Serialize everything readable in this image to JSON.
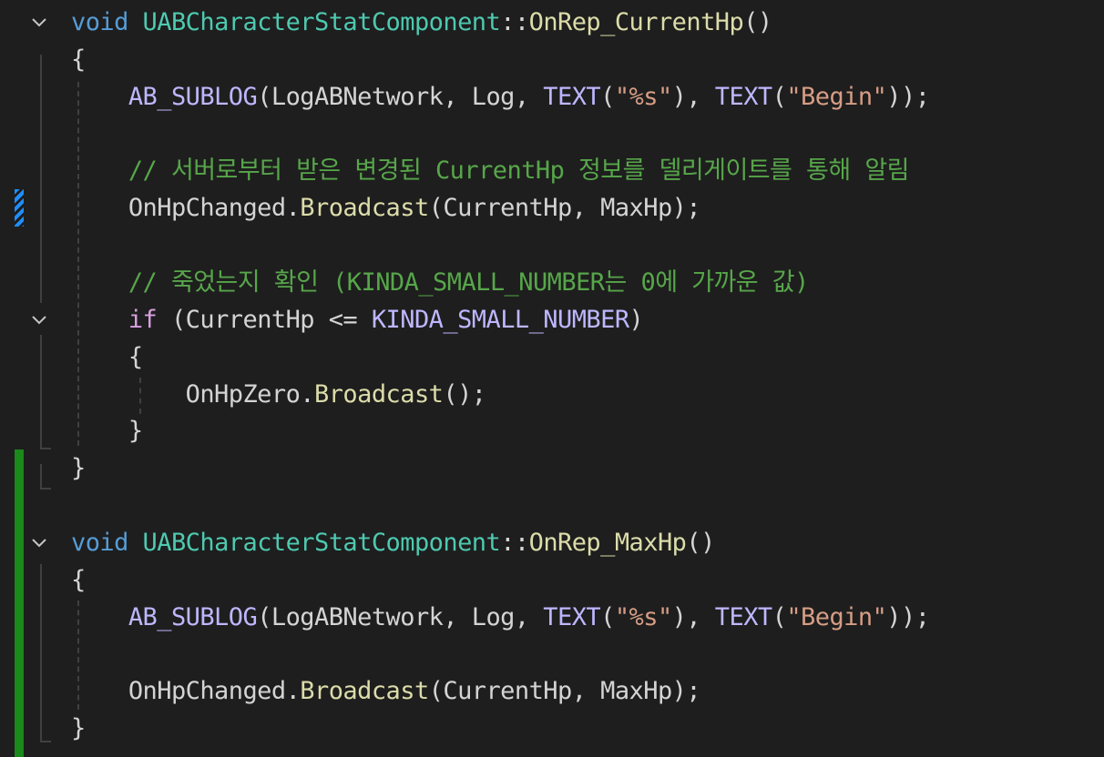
{
  "editor": {
    "lines": [
      {
        "foldable": true,
        "tokens": [
          {
            "t": "kw",
            "v": "void"
          },
          {
            "t": "p",
            "v": " "
          },
          {
            "t": "cls",
            "v": "UABCharacterStatComponent"
          },
          {
            "t": "p",
            "v": "::"
          },
          {
            "t": "fn",
            "v": "OnRep_CurrentHp"
          },
          {
            "t": "p",
            "v": "()"
          }
        ]
      },
      {
        "tokens": [
          {
            "t": "p",
            "v": "{"
          }
        ]
      },
      {
        "tokens": [
          {
            "t": "p",
            "v": "    "
          },
          {
            "t": "macro",
            "v": "AB_SUBLOG"
          },
          {
            "t": "p",
            "v": "(LogABNetwork, Log, "
          },
          {
            "t": "macro",
            "v": "TEXT"
          },
          {
            "t": "p",
            "v": "("
          },
          {
            "t": "str",
            "v": "\"%s\""
          },
          {
            "t": "p",
            "v": "), "
          },
          {
            "t": "macro",
            "v": "TEXT"
          },
          {
            "t": "p",
            "v": "("
          },
          {
            "t": "str",
            "v": "\"Begin\""
          },
          {
            "t": "p",
            "v": "));"
          }
        ]
      },
      {
        "tokens": []
      },
      {
        "tokens": [
          {
            "t": "p",
            "v": "    "
          },
          {
            "t": "cmt",
            "v": "// 서버로부터 받은 변경된 CurrentHp 정보를 델리게이트를 통해 알림"
          }
        ]
      },
      {
        "tokens": [
          {
            "t": "p",
            "v": "    OnHpChanged."
          },
          {
            "t": "fn",
            "v": "Broadcast"
          },
          {
            "t": "p",
            "v": "(CurrentHp, MaxHp);"
          }
        ]
      },
      {
        "tokens": []
      },
      {
        "tokens": [
          {
            "t": "p",
            "v": "    "
          },
          {
            "t": "cmt",
            "v": "// 죽었는지 확인 (KINDA_SMALL_NUMBER는 0에 가까운 값)"
          }
        ]
      },
      {
        "foldable": true,
        "tokens": [
          {
            "t": "p",
            "v": "    "
          },
          {
            "t": "ctl",
            "v": "if"
          },
          {
            "t": "p",
            "v": " (CurrentHp <= "
          },
          {
            "t": "macro",
            "v": "KINDA_SMALL_NUMBER"
          },
          {
            "t": "p",
            "v": ")"
          }
        ]
      },
      {
        "tokens": [
          {
            "t": "p",
            "v": "    {"
          }
        ]
      },
      {
        "tokens": [
          {
            "t": "p",
            "v": "        OnHpZero."
          },
          {
            "t": "fn",
            "v": "Broadcast"
          },
          {
            "t": "p",
            "v": "();"
          }
        ]
      },
      {
        "tokens": [
          {
            "t": "p",
            "v": "    }"
          }
        ]
      },
      {
        "tokens": [
          {
            "t": "p",
            "v": "}"
          }
        ]
      },
      {
        "tokens": []
      },
      {
        "foldable": true,
        "tokens": [
          {
            "t": "kw",
            "v": "void"
          },
          {
            "t": "p",
            "v": " "
          },
          {
            "t": "cls",
            "v": "UABCharacterStatComponent"
          },
          {
            "t": "p",
            "v": "::"
          },
          {
            "t": "fn",
            "v": "OnRep_MaxHp"
          },
          {
            "t": "p",
            "v": "()"
          }
        ]
      },
      {
        "tokens": [
          {
            "t": "p",
            "v": "{"
          }
        ]
      },
      {
        "tokens": [
          {
            "t": "p",
            "v": "    "
          },
          {
            "t": "macro",
            "v": "AB_SUBLOG"
          },
          {
            "t": "p",
            "v": "(LogABNetwork, Log, "
          },
          {
            "t": "macro",
            "v": "TEXT"
          },
          {
            "t": "p",
            "v": "("
          },
          {
            "t": "str",
            "v": "\"%s\""
          },
          {
            "t": "p",
            "v": "), "
          },
          {
            "t": "macro",
            "v": "TEXT"
          },
          {
            "t": "p",
            "v": "("
          },
          {
            "t": "str",
            "v": "\"Begin\""
          },
          {
            "t": "p",
            "v": "));"
          }
        ]
      },
      {
        "tokens": []
      },
      {
        "tokens": [
          {
            "t": "p",
            "v": "    OnHpChanged."
          },
          {
            "t": "fn",
            "v": "Broadcast"
          },
          {
            "t": "p",
            "v": "(CurrentHp, MaxHp);"
          }
        ]
      },
      {
        "tokens": [
          {
            "t": "p",
            "v": "}"
          }
        ]
      }
    ]
  },
  "theme": {
    "background": "#1e1e1e",
    "keyword": "#569cd6",
    "type": "#4ec9b0",
    "function": "#dcdcaa",
    "macro": "#beb7ff",
    "string": "#d69d85",
    "comment": "#57a64a",
    "control": "#d8a0df",
    "text": "#d4d4d4",
    "added_marker": "#1a8a1a",
    "modified_marker": "#1e8fff"
  }
}
